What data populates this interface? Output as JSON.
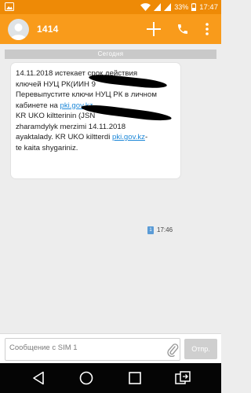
{
  "status_bar": {
    "battery_percent": "33%",
    "time": "17:47"
  },
  "app_bar": {
    "contact_name": "1414"
  },
  "conversation": {
    "date_separator": "Сегодня",
    "message": {
      "line1": "14.11.2018 истекает срок действия",
      "line2": "ключей НУЦ РК(ИИН 9",
      "line3": "Перевыпустите ключи НУЦ РК в личном",
      "line4_prefix": "кабинете на ",
      "link": "pki.gov.kz",
      "line5": "KR UKO kiltterinin (JSN",
      "line6": "zharamdylyk merzimi 14.11.2018",
      "line7": "ayaktalady. KR UKO kiltterdi ",
      "line7_link": "pki.gov.kz",
      "line7_suffix": "-",
      "line8": "te kaita shygariniz.",
      "sim_badge": "1",
      "time": "17:46"
    }
  },
  "composer": {
    "placeholder": "Сообщение с SIM 1",
    "send_label": "Отпр."
  },
  "colors": {
    "status_bar": "#ee8a06",
    "app_bar": "#f99b1b",
    "link": "#1e88d8"
  }
}
